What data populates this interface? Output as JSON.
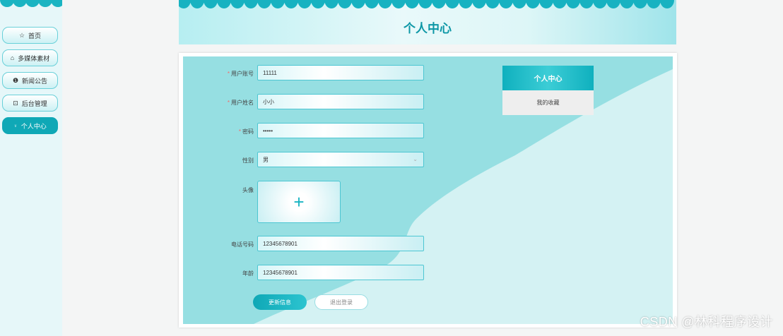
{
  "sidebar": {
    "items": [
      {
        "icon": "star-icon",
        "glyph": "☆",
        "label": "首页"
      },
      {
        "icon": "bag-icon",
        "glyph": "⌂",
        "label": "多媒体素材"
      },
      {
        "icon": "info-icon",
        "glyph": "❶",
        "label": "新闻公告"
      },
      {
        "icon": "admin-icon",
        "glyph": "⊡",
        "label": "后台管理"
      },
      {
        "icon": "user-icon",
        "glyph": "⍤",
        "label": "个人中心"
      }
    ]
  },
  "header": {
    "title": "个人中心"
  },
  "form": {
    "account": {
      "label": "用户账号",
      "value": "11111",
      "required": true
    },
    "name": {
      "label": "用户姓名",
      "value": "小小",
      "required": true
    },
    "password": {
      "label": "密码",
      "value": "•••••",
      "required": true
    },
    "gender": {
      "label": "性别",
      "value": "男",
      "required": false
    },
    "avatar": {
      "label": "头像",
      "plus": "+"
    },
    "phone": {
      "label": "电话号码",
      "value": "12345678901"
    },
    "age": {
      "label": "年龄",
      "value": "12345678901"
    },
    "req_mark": "*"
  },
  "buttons": {
    "update": "更新信息",
    "logout": "退出登录"
  },
  "right_menu": {
    "title": "个人中心",
    "item": "我的收藏"
  },
  "watermark": "CSDN @林科程序设计",
  "colors": {
    "accent": "#0fa8b6",
    "accent_light": "#d4f2f3",
    "wave": "#96dfe2"
  }
}
